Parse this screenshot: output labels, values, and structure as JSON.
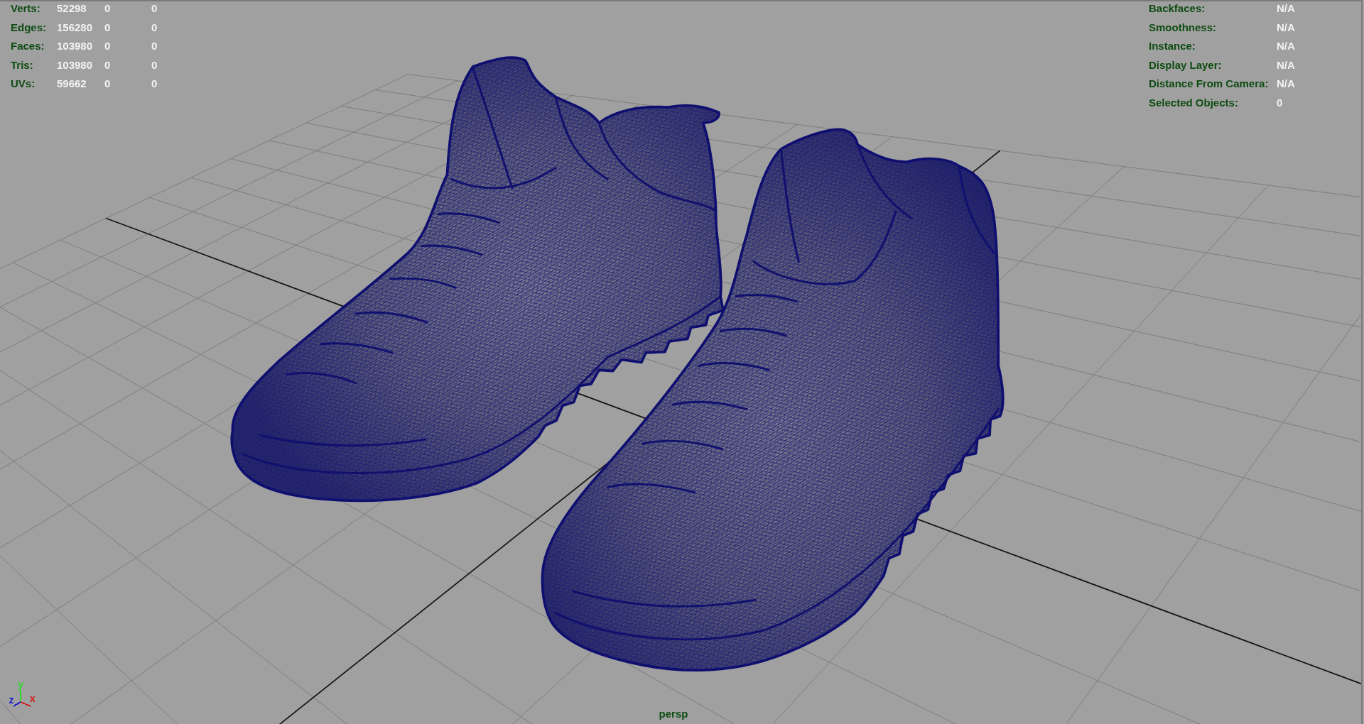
{
  "viewport": {
    "camera_name": "persp"
  },
  "hud_left": [
    {
      "label": "Verts:",
      "values": [
        "52298",
        "0",
        "0"
      ]
    },
    {
      "label": "Edges:",
      "values": [
        "156280",
        "0",
        "0"
      ]
    },
    {
      "label": "Faces:",
      "values": [
        "103980",
        "0",
        "0"
      ]
    },
    {
      "label": "Tris:",
      "values": [
        "103980",
        "0",
        "0"
      ]
    },
    {
      "label": "UVs:",
      "values": [
        "59662",
        "0",
        "0"
      ]
    }
  ],
  "hud_right": [
    {
      "label": "Backfaces:",
      "value": "N/A"
    },
    {
      "label": "Smoothness:",
      "value": "N/A"
    },
    {
      "label": "Instance:",
      "value": "N/A"
    },
    {
      "label": "Display Layer:",
      "value": "N/A"
    },
    {
      "label": "Distance From Camera:",
      "value": "N/A"
    },
    {
      "label": "Selected Objects:",
      "value": "0"
    }
  ],
  "view_axes": [
    {
      "kind": "up",
      "label": "y",
      "color": "#2ed82e"
    },
    {
      "kind": "depth",
      "label": "z",
      "color": "#1c1ccc"
    },
    {
      "kind": "side",
      "label": "x",
      "color": "#d42020"
    }
  ]
}
